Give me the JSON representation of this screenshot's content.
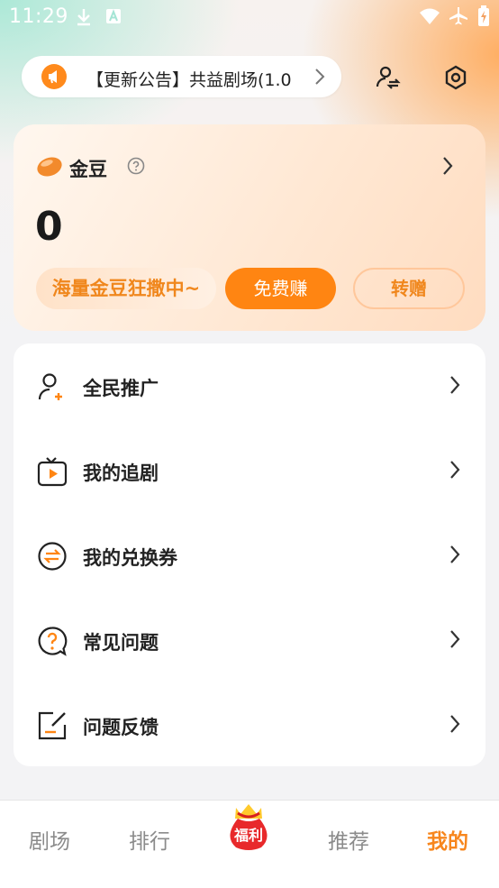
{
  "status_bar": {
    "time": "11:29"
  },
  "notice": {
    "text": "【更新公告】共益剧场(1.0"
  },
  "coins": {
    "title": "金豆",
    "value": "0",
    "promo": "海量金豆狂撒中~",
    "earn_label": "免费赚",
    "gift_label": "转赠"
  },
  "menu": [
    {
      "label": "全民推广",
      "icon": "user-plus-icon"
    },
    {
      "label": "我的追剧",
      "icon": "tv-icon"
    },
    {
      "label": "我的兑换券",
      "icon": "exchange-icon"
    },
    {
      "label": "常见问题",
      "icon": "question-bubble-icon"
    },
    {
      "label": "问题反馈",
      "icon": "edit-icon"
    }
  ],
  "tabs": [
    {
      "label": "剧场"
    },
    {
      "label": "排行"
    },
    {
      "label": "福利"
    },
    {
      "label": "推荐"
    },
    {
      "label": "我的"
    }
  ],
  "colors": {
    "accent": "#ff8512",
    "accent_text": "#f7861d"
  }
}
